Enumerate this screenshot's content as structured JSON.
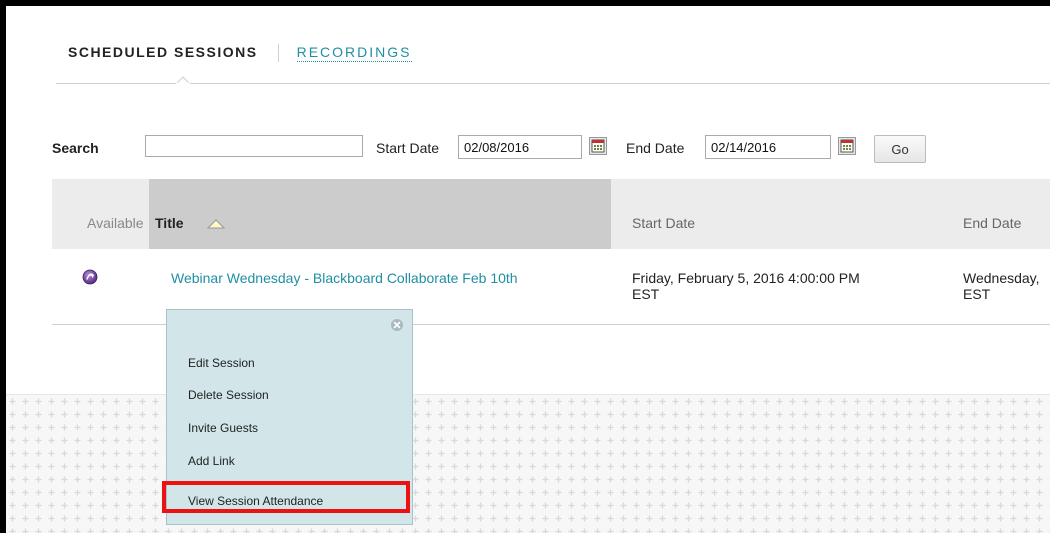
{
  "tabs": {
    "scheduled": "SCHEDULED SESSIONS",
    "recordings": "RECORDINGS"
  },
  "search": {
    "label": "Search",
    "value": "",
    "start_label": "Start Date",
    "start_value": "02/08/2016",
    "end_label": "End Date",
    "end_value": "02/14/2016",
    "go_label": "Go"
  },
  "table": {
    "headers": {
      "available": "Available",
      "title": "Title",
      "start": "Start Date",
      "end": "End Date"
    },
    "rows": [
      {
        "title": "Webinar Wednesday - Blackboard Collaborate Feb 10th",
        "start_line1": "Friday, February 5, 2016 4:00:00 PM",
        "start_line2": "EST",
        "end_line1": "Wednesday,",
        "end_line2": "EST"
      }
    ]
  },
  "menu": {
    "items": [
      "Edit Session",
      "Delete Session",
      "Invite Guests",
      "Add Link",
      "View Session Attendance"
    ]
  },
  "colors": {
    "link": "#1f8fa4",
    "menu_bg": "#d2e6ea",
    "highlight": "#ee1111",
    "header_sorted": "#cccccc"
  }
}
